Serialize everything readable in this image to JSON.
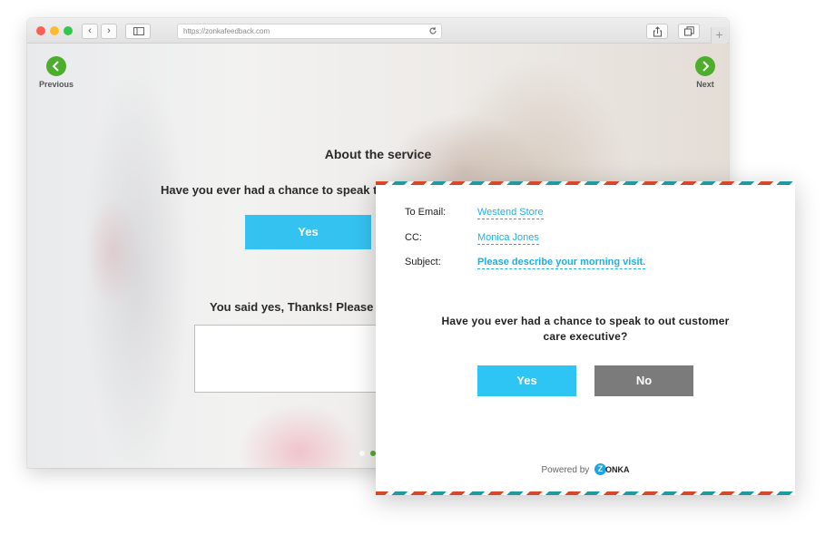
{
  "browser": {
    "url": "https://zonkafeedback.com",
    "back_glyph": "‹",
    "forward_glyph": "›",
    "new_tab_glyph": "+"
  },
  "survey_page": {
    "previous_label": "Previous",
    "next_label": "Next",
    "section_title": "About the service",
    "question_visible": "Have you ever had a chance to speak to",
    "yes_label": "Yes",
    "followup_visible": "You said yes, Thanks! Please h",
    "accent_color": "#4cae2a",
    "button_color": "#34c3f1"
  },
  "email_card": {
    "to_label": "To Email:",
    "to_value": "Westend Store",
    "cc_label": "CC:",
    "cc_value": "Monica Jones",
    "subject_label": "Subject:",
    "subject_value": "Please describe your morning visit.",
    "question": "Have you ever had a chance to speak to out customer care executive?",
    "yes_label": "Yes",
    "no_label": "No",
    "powered_by": "Powered by",
    "brand_initial": "Z",
    "brand_rest": "ONKA",
    "link_color": "#1db0e5",
    "yes_color": "#2ec4f3",
    "no_color": "#7b7b7b"
  }
}
